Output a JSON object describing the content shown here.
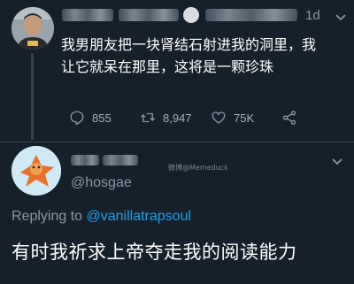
{
  "parent_tweet": {
    "time": "1d",
    "text_line1": "我男朋友把一块肾结石射进我的洞里，我",
    "text_line2": "让它就呆在那里，这将是一颗珍珠",
    "actions": {
      "replies": "855",
      "retweets": "8,947",
      "likes": "75K"
    }
  },
  "reply_tweet": {
    "handle": "@hosgae",
    "watermark": "微博@Memeduck",
    "replying_prefix": "Replying to ",
    "replying_to": "@vanillatrapsoul",
    "text": "有时我祈求上帝夺走我的阅读能力"
  },
  "icons": {
    "reply": "reply-icon",
    "retweet": "retweet-icon",
    "like": "heart-icon",
    "share": "share-icon",
    "more": "chevron-down-icon"
  },
  "colors": {
    "background": "#15202b",
    "secondary_text": "#8899a6",
    "link": "#1da1f2",
    "divider": "#38444d"
  }
}
